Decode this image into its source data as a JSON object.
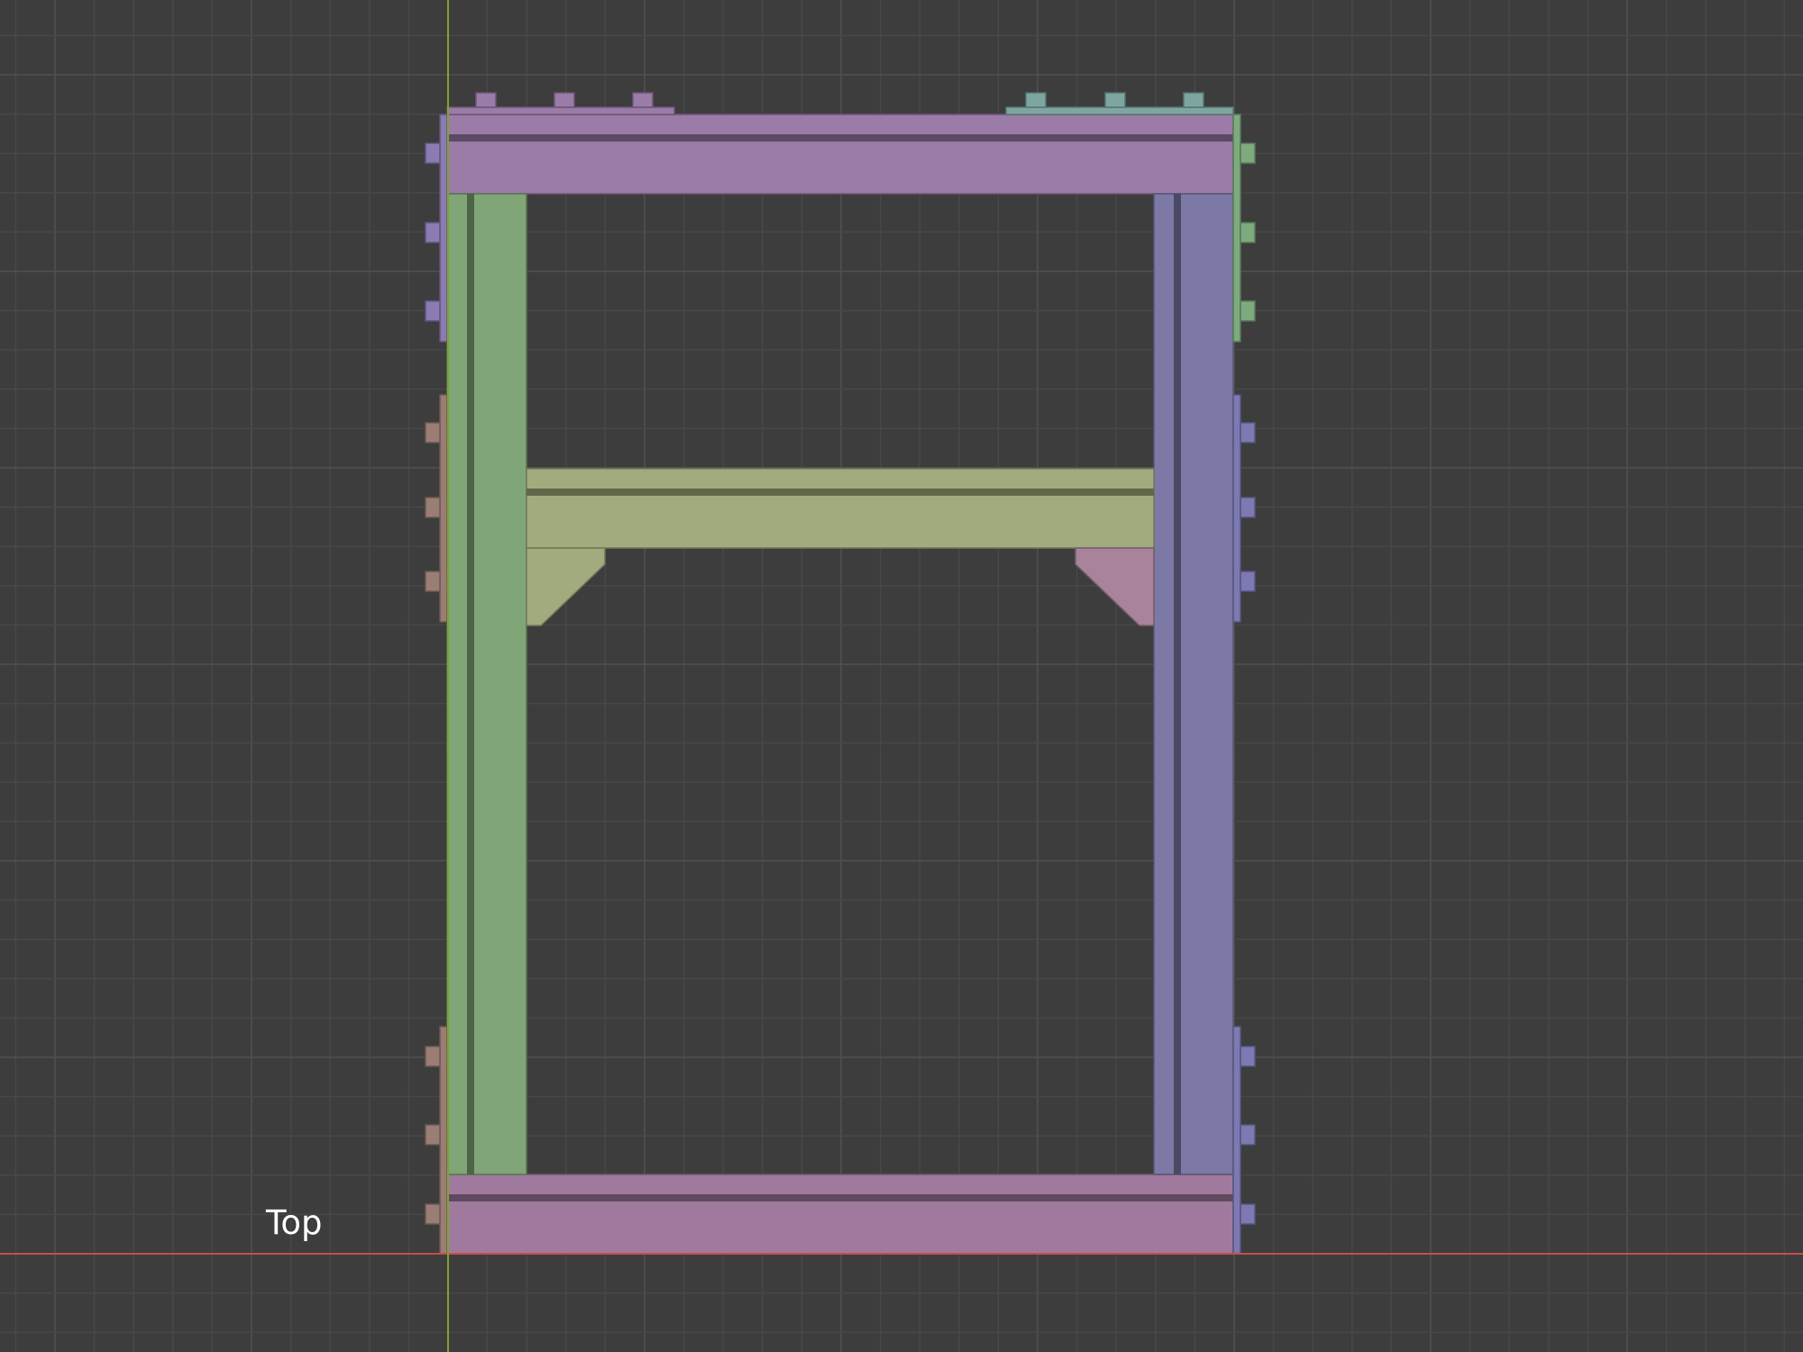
{
  "viewport": {
    "view_label": "Top",
    "background": "#3d3d3d",
    "grid_minor_color": "#484848",
    "grid_major_color": "#515151",
    "x_axis_color": "#c94b4b",
    "y_axis_color": "#7ea52d"
  },
  "objects": [
    {
      "name": "top-beam",
      "color": "#9b7ba7"
    },
    {
      "name": "bottom-beam",
      "color": "#a07a9e"
    },
    {
      "name": "left-post",
      "color": "#80a677"
    },
    {
      "name": "right-post",
      "color": "#7c79a6"
    },
    {
      "name": "middle-crossbar",
      "color": "#a2ab7d"
    },
    {
      "name": "left-gusset",
      "color": "#a2ab7d"
    },
    {
      "name": "right-gusset",
      "color": "#a88399"
    },
    {
      "name": "top-left-connector",
      "color": "#9b7ba7"
    },
    {
      "name": "top-right-connector",
      "color": "#7ea6a0"
    },
    {
      "name": "right-upper-connector",
      "color": "#7dab7e"
    },
    {
      "name": "left-upper-connector",
      "color": "#8b7bb2"
    },
    {
      "name": "left-middle-connector",
      "color": "#9a7e75"
    },
    {
      "name": "right-middle-connector",
      "color": "#7c79b3"
    },
    {
      "name": "left-lower-connector",
      "color": "#9a7e75"
    },
    {
      "name": "right-lower-connector",
      "color": "#7c79b3"
    }
  ]
}
